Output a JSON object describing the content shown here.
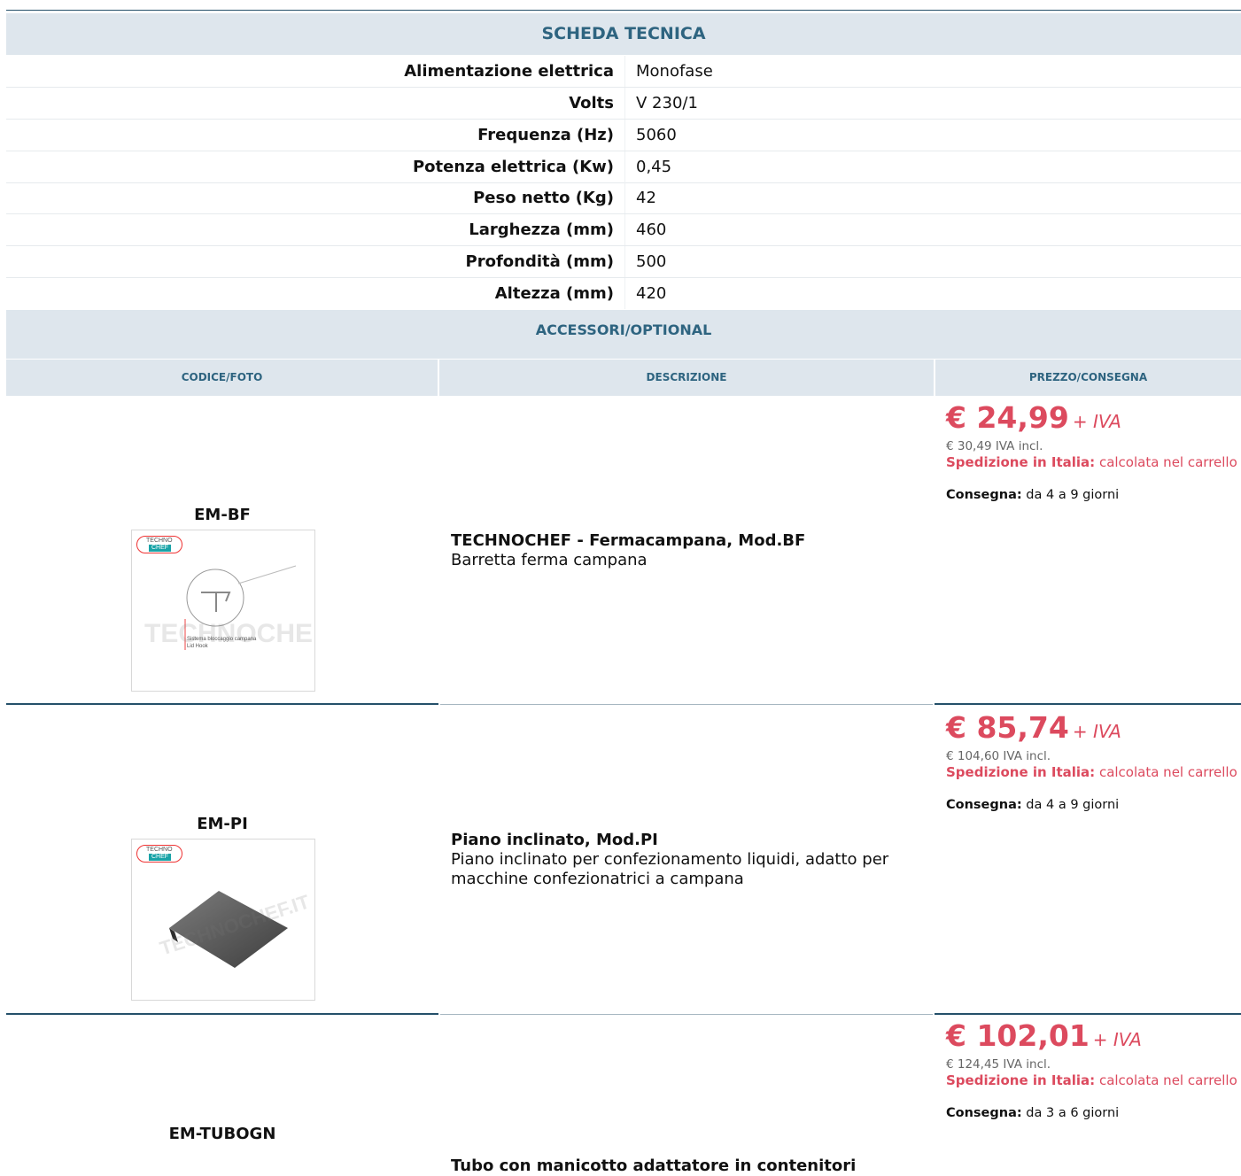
{
  "spec_table": {
    "title": "SCHEDA TECNICA",
    "rows": [
      {
        "label": "Alimentazione elettrica",
        "value": "Monofase"
      },
      {
        "label": "Volts",
        "value": "V 230/1"
      },
      {
        "label": "Frequenza (Hz)",
        "value": "5060"
      },
      {
        "label": "Potenza elettrica (Kw)",
        "value": "0,45"
      },
      {
        "label": "Peso netto (Kg)",
        "value": "42"
      },
      {
        "label": "Larghezza (mm)",
        "value": "460"
      },
      {
        "label": "Profondità (mm)",
        "value": "500"
      },
      {
        "label": "Altezza (mm)",
        "value": "420"
      }
    ]
  },
  "accessories": {
    "title": "ACCESSORI/OPTIONAL",
    "columns": [
      "CODICE/FOTO",
      "DESCRIZIONE",
      "PREZZO/CONSEGNA"
    ],
    "items": [
      {
        "code": "EM-BF",
        "desc_title": "TECHNOCHEF - Fermacampana, Mod.BF",
        "desc_text": "Barretta ferma campana",
        "price": "€ 24,99",
        "iva": "+ IVA",
        "incl": "€ 30,49 IVA incl.",
        "ship_label": "Spedizione in Italia:",
        "ship_text": "calcolata nel carrello",
        "delivery_label": "Consegna:",
        "delivery_text": "da 4 a 9 giorni",
        "image_caption_1": "Sistema bloccaggio campana",
        "image_caption_2": "Lid Hook",
        "image_icon": "lid-hook-drawing"
      },
      {
        "code": "EM-PI",
        "desc_title": "Piano inclinato, Mod.PI",
        "desc_text": "Piano inclinato per confezionamento liquidi, adatto per macchine confezionatrici a campana",
        "price": "€ 85,74",
        "iva": "+ IVA",
        "incl": "€ 104,60 IVA incl.",
        "ship_label": "Spedizione in Italia:",
        "ship_text": "calcolata nel carrello",
        "delivery_label": "Consegna:",
        "delivery_text": "da 4 a 9 giorni",
        "image_icon": "inclined-plate"
      },
      {
        "code": "EM-TUBOGN",
        "desc_title": "Tubo con manicotto adattatore in contenitori",
        "desc_text": "",
        "price": "€ 102,01",
        "iva": "+ IVA",
        "incl": "€ 124,45 IVA incl.",
        "ship_label": "Spedizione in Italia:",
        "ship_text": "calcolata nel carrello",
        "delivery_label": "Consegna:",
        "delivery_text": "da 3 a 6 giorni"
      }
    ]
  },
  "logo": {
    "top": "TECHNO",
    "bottom": "CHEF"
  },
  "watermark": "TECHNOCHEF.IT",
  "colors": {
    "accent": "#dc4a5e",
    "header_bg": "#dee6ed",
    "header_text": "#2e6480",
    "rule": "#25506a"
  }
}
